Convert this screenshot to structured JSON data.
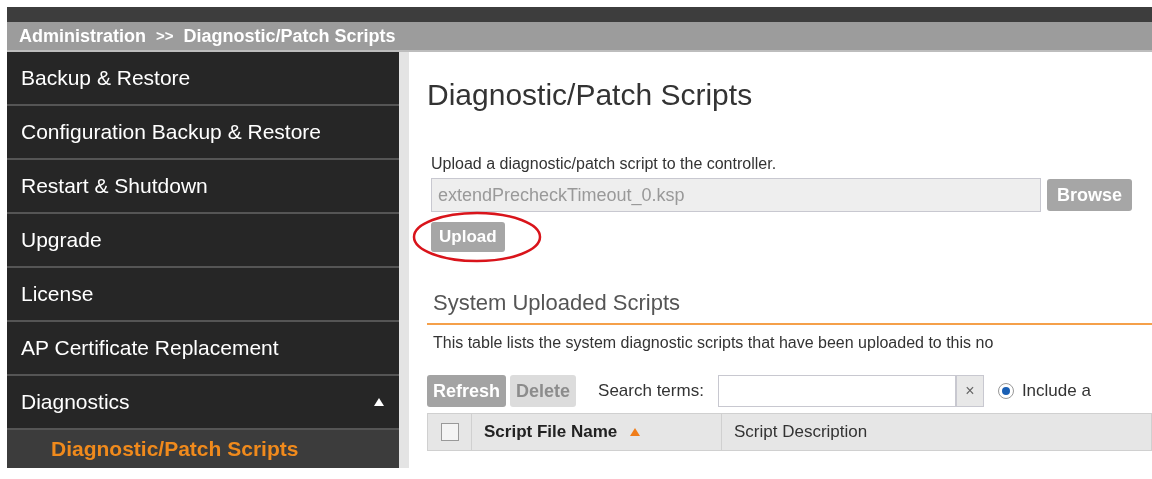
{
  "breadcrumb": {
    "items": [
      "Administration",
      "Diagnostic/Patch Scripts"
    ],
    "separator": ">>"
  },
  "sidebar": {
    "items": [
      {
        "label": "Backup & Restore",
        "selected": false
      },
      {
        "label": "Configuration Backup & Restore",
        "selected": false
      },
      {
        "label": "Restart & Shutdown",
        "selected": false
      },
      {
        "label": "Upgrade",
        "selected": false
      },
      {
        "label": "License",
        "selected": false
      },
      {
        "label": "AP Certificate Replacement",
        "selected": false
      },
      {
        "label": "Diagnostics",
        "selected": false,
        "expanded": true,
        "children": [
          {
            "label": "Diagnostic/Patch Scripts",
            "selected": true
          }
        ]
      }
    ]
  },
  "page_title": "Diagnostic/Patch Scripts",
  "upload": {
    "label": "Upload a diagnostic/patch script to the controller.",
    "file_value": "extendPrecheckTimeout_0.ksp",
    "browse_button": "Browse",
    "upload_button": "Upload",
    "highlighted": true
  },
  "section": {
    "title": "System Uploaded Scripts",
    "description": "This table lists the system diagnostic scripts that have been uploaded to this no"
  },
  "toolbar": {
    "buttons": [
      {
        "label": "Refresh",
        "disabled": false
      },
      {
        "label": "Delete",
        "disabled": true
      }
    ],
    "search_label": "Search terms:",
    "clear": "×",
    "radio": {
      "label": "Include a",
      "selected": true
    }
  },
  "table": {
    "select_all_checked": false,
    "columns": [
      {
        "label": "Script File Name",
        "sorted": true
      },
      {
        "label": "Script Description",
        "sorted": false
      }
    ]
  }
}
